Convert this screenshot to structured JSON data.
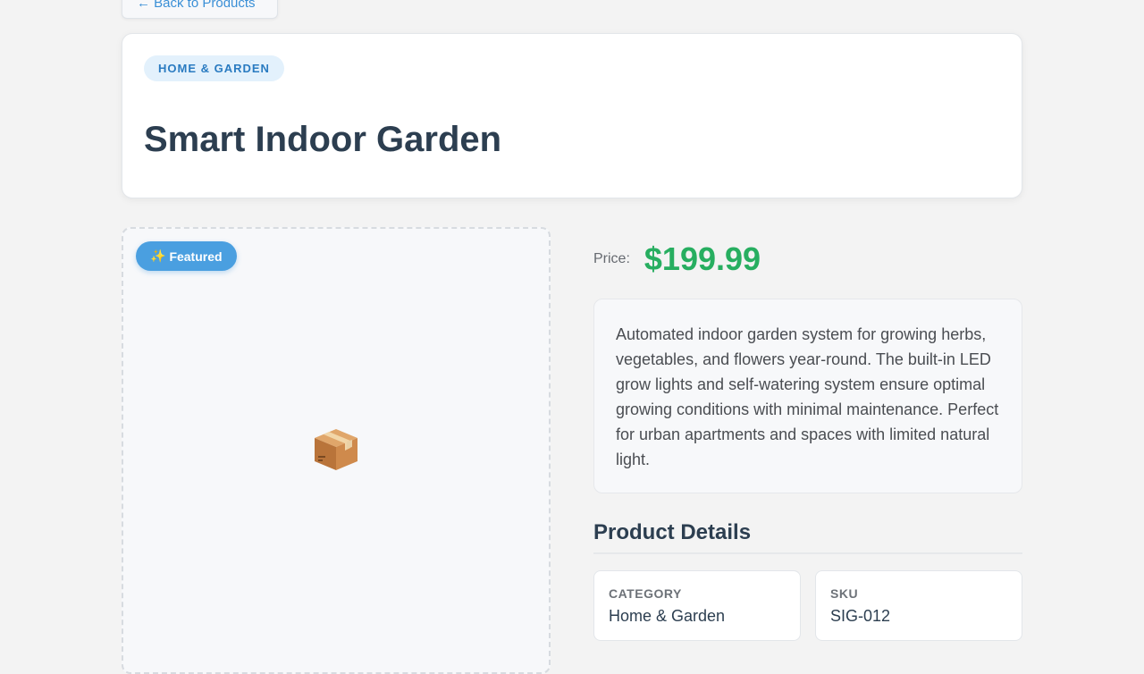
{
  "nav": {
    "back_label": "← Back to Products"
  },
  "header": {
    "category_pill": "HOME & GARDEN",
    "title": "Smart Indoor Garden"
  },
  "image_panel": {
    "badge_icon": "✨",
    "badge_label": "Featured",
    "placeholder_icon": "package-icon"
  },
  "price": {
    "label": "Price:",
    "value": "$199.99"
  },
  "description": "Automated indoor garden system for growing herbs, vegetables, and flowers year-round. The built-in LED grow lights and self-watering system ensure optimal growing conditions with minimal maintenance. Perfect for urban apartments and spaces with limited natural light.",
  "details": {
    "heading": "Product Details",
    "items": [
      {
        "label": "CATEGORY",
        "value": "Home & Garden"
      },
      {
        "label": "SKU",
        "value": "SIG-012"
      }
    ]
  },
  "colors": {
    "accent": "#3a8fd6",
    "price": "#27ae60",
    "badge": "#4a9fe0",
    "title": "#2c3e50"
  }
}
